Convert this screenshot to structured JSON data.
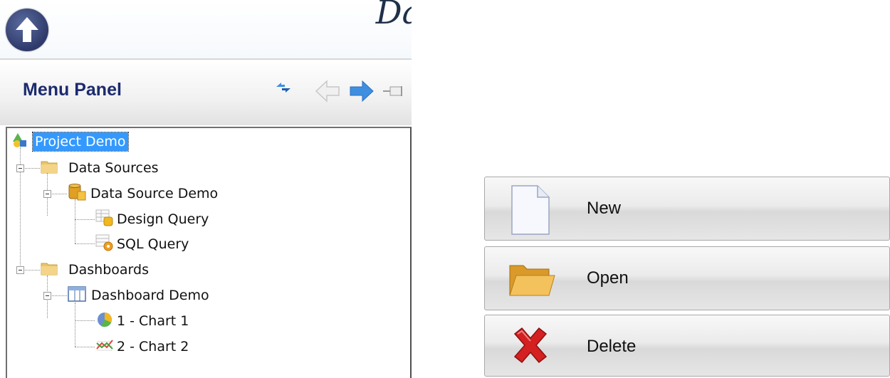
{
  "app": {
    "title_fragment": "Da"
  },
  "menu_panel": {
    "title": "Menu Panel"
  },
  "tree": {
    "root": "Project Demo",
    "data_sources": "Data Sources",
    "data_source_demo": "Data Source Demo",
    "design_query": "Design Query",
    "sql_query": "SQL Query",
    "dashboards": "Dashboards",
    "dashboard_demo": "Dashboard Demo",
    "chart1": "1 - Chart 1",
    "chart2": "2 - Chart 2"
  },
  "actions": {
    "new": "New",
    "open": "Open",
    "delete": "Delete"
  },
  "icons": [
    "up-arrow-icon",
    "sync-icon",
    "back-arrow-icon",
    "forward-arrow-icon",
    "pin-icon",
    "project-icon",
    "folder-icon",
    "database-icon",
    "design-query-icon",
    "sql-query-icon",
    "dashboard-icon",
    "pie-chart-icon",
    "line-chart-icon",
    "new-document-icon",
    "open-folder-icon",
    "delete-icon"
  ],
  "colors": {
    "menu_title": "#1c2b6e",
    "selection": "#3399ff",
    "forward_arrow": "#3f8fe0",
    "delete_red": "#d42020"
  }
}
